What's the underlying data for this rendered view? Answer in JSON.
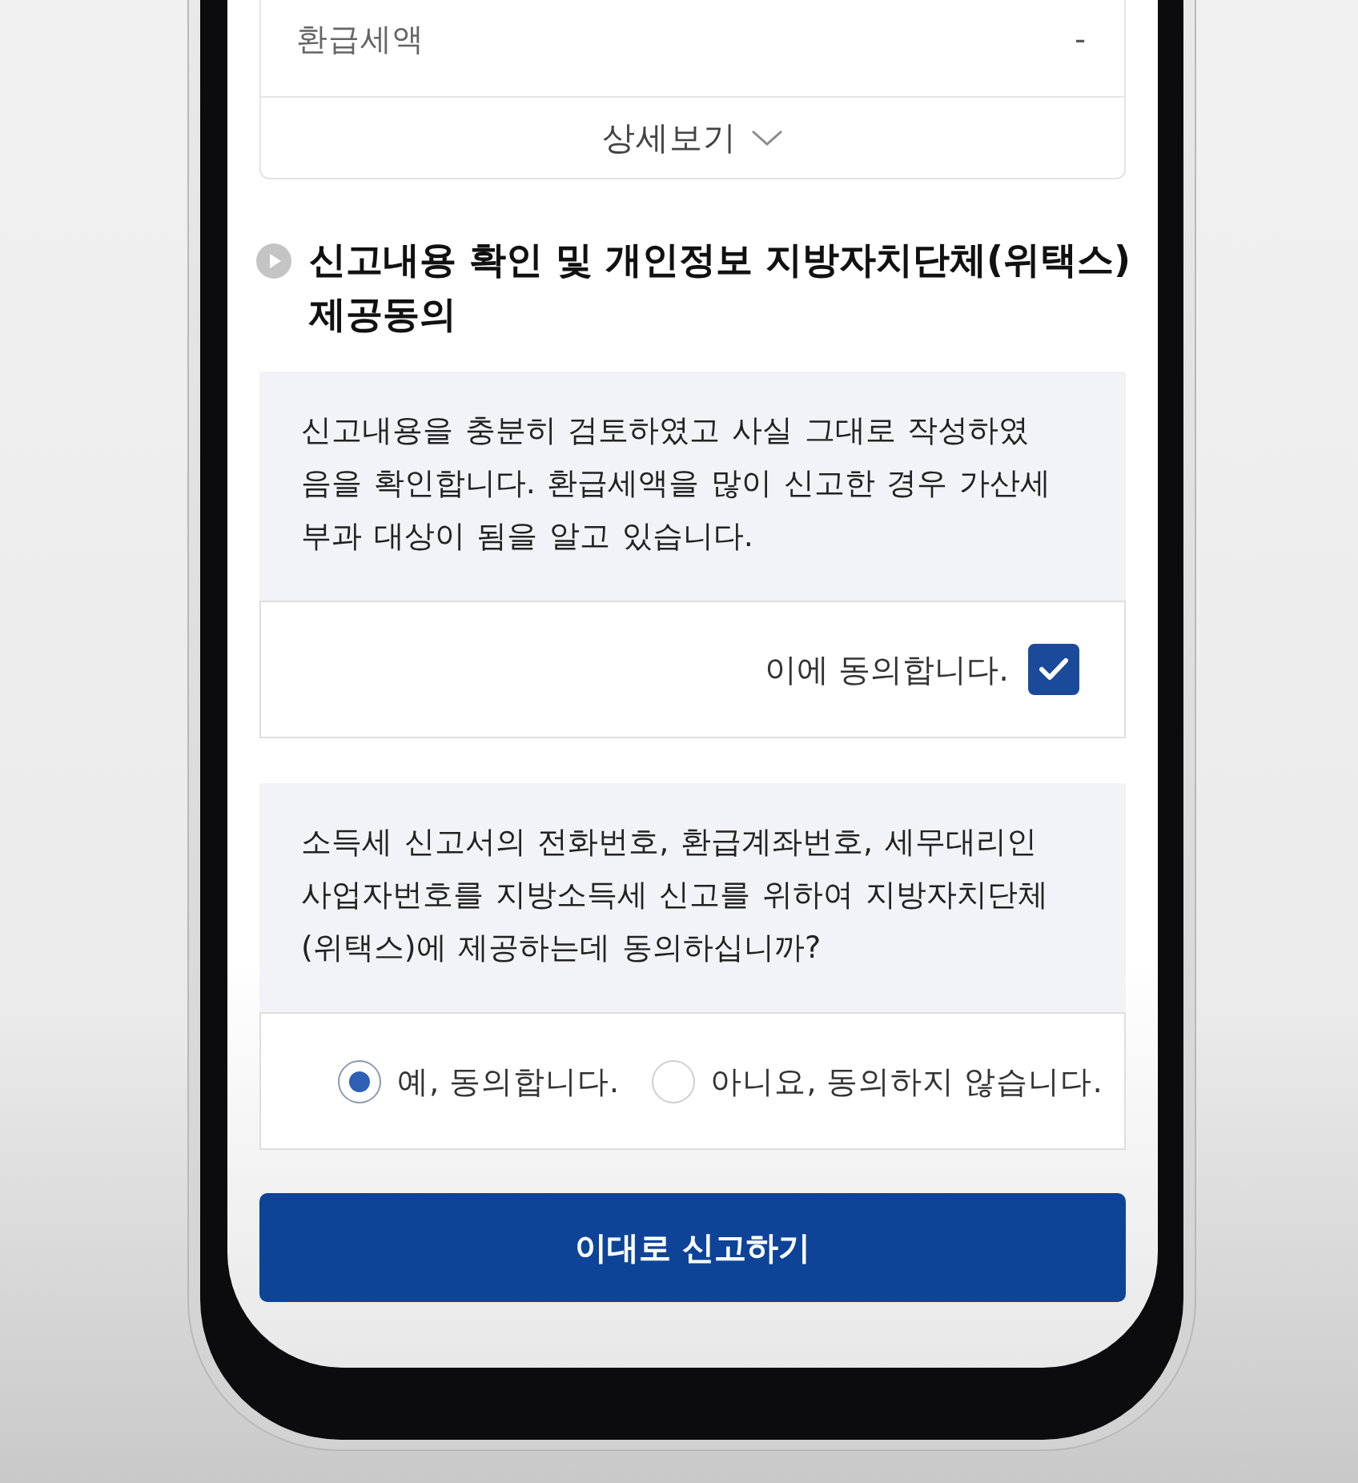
{
  "summary_card": {
    "rows": [
      {
        "label": "환급세액",
        "value": "-"
      }
    ],
    "details_toggle": {
      "label": "상세보기",
      "expanded": false
    }
  },
  "section": {
    "title": "신고내용 확인 및 개인정보 지방자치단체(위택스) 제공동의"
  },
  "confirmation": {
    "text": "신고내용을 충분히 검토하였고 사실 그대로 작성하였음을 확인합니다. 환급세액을 많이 신고한 경우 가산세 부과 대상이 됨을 알고 있습니다.",
    "agree_label": "이에 동의합니다.",
    "checked": true
  },
  "consent_question": {
    "text": "소득세 신고서의 전화번호, 환급계좌번호, 세무대리인 사업자번호를 지방소득세 신고를 위하여 지방자치단체(위택스)에 제공하는데 동의하십니까?",
    "options": [
      {
        "label": "예, 동의합니다.",
        "selected": true
      },
      {
        "label": "아니요, 동의하지 않습니다.",
        "selected": false
      }
    ]
  },
  "submit_button": {
    "label": "이대로 신고하기"
  }
}
